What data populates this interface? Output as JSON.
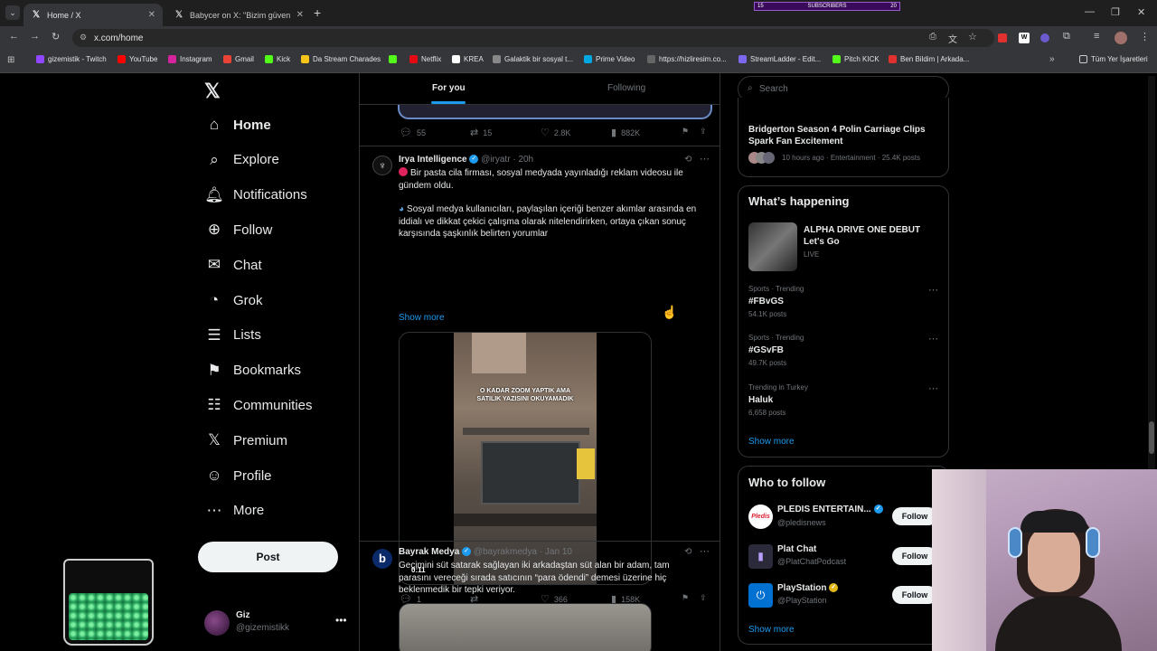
{
  "browser": {
    "tabs": [
      {
        "title": "Home / X",
        "active": true
      },
      {
        "title": "Babycer on X: \"Bizim güven yer"
      }
    ],
    "subscribers_widget": {
      "label": "SUBSCRIBERS",
      "left_value": "15",
      "right_value": "20"
    },
    "url": "x.com/home",
    "bookmarks": [
      "gizemistik - Twitch",
      "YouTube",
      "Instagram",
      "Gmail",
      "Kick",
      "Da Stream Charades",
      "Netflix",
      "KREA",
      "Galaktik bir sosyal t...",
      "Prime Video",
      "https://hizliresim.co...",
      "StreamLadder - Edit...",
      "Pitch KICK",
      "Ben Bildim | Arkada...",
      "Tüm Yer İşaretleri"
    ]
  },
  "sidebar": {
    "nav": [
      {
        "label": "Home",
        "icon": "home-icon"
      },
      {
        "label": "Explore",
        "icon": "search-icon"
      },
      {
        "label": "Notifications",
        "icon": "bell-icon"
      },
      {
        "label": "Follow",
        "icon": "person-add-icon"
      },
      {
        "label": "Chat",
        "icon": "mail-icon"
      },
      {
        "label": "Grok",
        "icon": "grok-icon"
      },
      {
        "label": "Lists",
        "icon": "list-icon"
      },
      {
        "label": "Bookmarks",
        "icon": "bookmark-icon"
      },
      {
        "label": "Communities",
        "icon": "people-icon"
      },
      {
        "label": "Premium",
        "icon": "x-logo-icon"
      },
      {
        "label": "Profile",
        "icon": "person-icon"
      },
      {
        "label": "More",
        "icon": "more-circle-icon"
      }
    ],
    "post_button": "Post",
    "account": {
      "name": "Giz",
      "handle": "@gizemistikk"
    }
  },
  "feed": {
    "tabs": {
      "for_you": "For you",
      "following": "Following"
    },
    "prev_tweet_stats": {
      "replies": "55",
      "reposts": "15",
      "likes": "2.8K",
      "views": "882K"
    },
    "tweet1": {
      "author": "Irya Intelligence",
      "handle": "@iryatr",
      "time": "20h",
      "line1": "Bir pasta cila firması, sosyal medyada yayınladığı reklam videosu ile gündem oldu.",
      "line2": "Sosyal medya kullanıcıları, paylaşılan içeriği benzer akımlar arasında en iddialı ve dikkat çekici çalışma olarak nitelendirirken, ortaya çıkan sonuç karşısında şaşkınlık belirten yorumlar",
      "show_more": "Show more",
      "video_caption": "O KADAR ZOOM YAPTIK AMA SATILIK YAZISINI OKUYAMADIK",
      "duration": "0:11",
      "stats": {
        "replies": "1",
        "reposts": "",
        "likes": "366",
        "views": "158K"
      }
    },
    "tweet2": {
      "author": "Bayrak Medya",
      "handle": "@bayrakmedya",
      "time": "Jan 10",
      "text": "Geçimini süt satarak sağlayan iki arkadaştan süt alan bir adam, tam parasını vereceği sırada satıcının “para ödendi” demesi üzerine hiç beklenmedik bir tepki veriyor."
    }
  },
  "right": {
    "search_placeholder": "Search",
    "news": {
      "title": "Bridgerton Season 4 Polin Carriage Clips Spark Fan Excitement",
      "meta": "10 hours ago · Entertainment · 25.4K posts"
    },
    "whats_happening": {
      "title": "What’s happening",
      "live": {
        "title": "ALPHA DRIVE ONE DEBUT Let's Go",
        "status": "LIVE"
      },
      "trends": [
        {
          "meta": "Sports · Trending",
          "name": "#FBvGS",
          "posts": "54.1K posts"
        },
        {
          "meta": "Sports · Trending",
          "name": "#GSvFB",
          "posts": "49.7K posts"
        },
        {
          "meta": "Trending in Turkey",
          "name": "Haluk",
          "posts": "6,658 posts"
        }
      ],
      "show_more": "Show more"
    },
    "who_to_follow": {
      "title": "Who to follow",
      "accounts": [
        {
          "name": "PLEDIS ENTERTAIN...",
          "handle": "@pledisnews",
          "button": "Follow"
        },
        {
          "name": "Plat Chat",
          "handle": "@PlatChatPodcast",
          "button": "Follow"
        },
        {
          "name": "PlayStation",
          "handle": "@PlayStation",
          "button": "Follow"
        }
      ],
      "show_more": "Show more"
    }
  },
  "colors": {
    "accent": "#1d9bf0",
    "background": "#000000",
    "border": "#2f3336"
  }
}
